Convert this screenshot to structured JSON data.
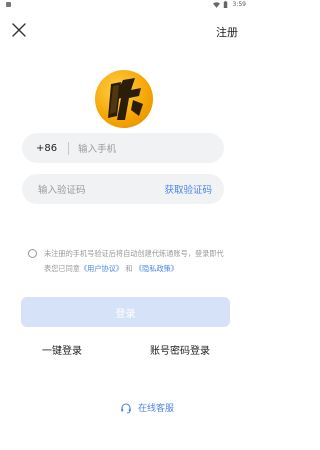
{
  "status": {
    "time": "3:59"
  },
  "header": {
    "register_label": "注册"
  },
  "phone": {
    "country_code": "+86",
    "placeholder": "输入手机"
  },
  "code": {
    "placeholder": "输入验证码",
    "get_code_label": "获取验证码"
  },
  "agreement": {
    "text_prefix": "未注册的手机号验证后将自动创建代练通账号，登录即代表您已同意",
    "user_agreement": "《用户协议》",
    "and": "和",
    "privacy_policy": "《隐私政策》"
  },
  "login": {
    "button_label": "登录",
    "one_click_label": "一键登录",
    "password_login_label": "账号密码登录"
  },
  "service": {
    "label": "在线客服"
  },
  "colors": {
    "accent": "#4a86e8",
    "login_button_disabled": "#d6e2f7",
    "input_background": "#f1f2f4",
    "logo": "#f5a300"
  },
  "icons": [
    "close-icon",
    "logo-icon",
    "headset-icon",
    "wifi-icon",
    "battery-icon"
  ]
}
